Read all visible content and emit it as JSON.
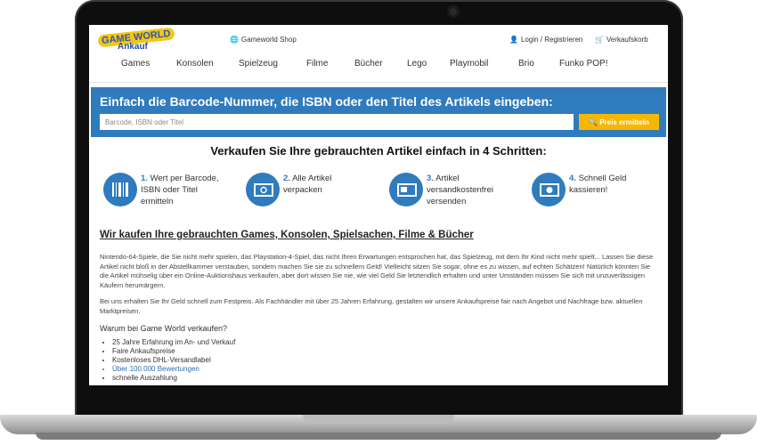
{
  "header": {
    "logo_top": "GAME WORLD",
    "logo_bottom": "Ankauf",
    "shop_link": "Gameworld Shop",
    "login_link": "Login / Registrieren",
    "cart_link": "Verkaufskorb"
  },
  "nav": [
    "Games",
    "Konsolen",
    "Spielzeug",
    "Filme",
    "Bücher",
    "Lego",
    "Playmobil",
    "Brio",
    "Funko POP!"
  ],
  "search": {
    "title": "Einfach die Barcode-Nummer, die ISBN oder den Titel des Artikels eingeben:",
    "placeholder": "Barcode, ISBN oder Titel",
    "button": "Preis ermitteln",
    "accent": "#2f7bbd",
    "button_color": "#f5b800"
  },
  "steps": {
    "title": "Verkaufen Sie Ihre gebrauchten Artikel einfach in 4 Schritten:",
    "items": [
      {
        "num": "1.",
        "text": "Wert per Barcode, ISBN oder Titel ermitteln",
        "icon": "barcode-icon"
      },
      {
        "num": "2.",
        "text": "Alle Artikel verpacken",
        "icon": "package-icon"
      },
      {
        "num": "3.",
        "text": "Artikel versandkostenfrei versenden",
        "icon": "shipping-icon"
      },
      {
        "num": "4.",
        "text": "Schnell Geld kassieren!",
        "icon": "money-icon"
      }
    ]
  },
  "content": {
    "heading": "Wir kaufen Ihre gebrauchten Games, Konsolen, Spielsachen, Filme & Bücher",
    "para1": "Nintendo-64-Spiele, die Sie nicht mehr spielen, das Playstation-4-Spiel, das nicht Ihren Erwartungen entsprochen hat, das Spielzeug, mit dem Ihr Kind nicht mehr spielt... Lassen Sie diese Artikel nicht bloß in der Abstellkammer verstauben, sondern machen Sie sie zu schnellem Geld! Vielleicht sitzen Sie sogar, ohne es zu wissen, auf echten Schätzen! Natürlich könnten Sie die Artikel mühselig über ein Online-Auktionshaus verkaufen, aber dort wissen Sie nie, wie viel Geld Sie letztendlich erhalten und unter Umständen müssen Sie sich mit unzuverlässigen Käufern herumärgern.",
    "para2": "Bei uns erhalten Sie Ihr Geld schnell zum Festpreis. Als Fachhändler mit über 25 Jahren Erfahrung, gestalten wir unsere Ankaufspreise fair nach Angebot und Nachfrage bzw. aktuellen Marktpreisen.",
    "why_title": "Warum bei Game World verkaufen?",
    "why_items": [
      "25 Jahre Erfahrung im An- und Verkauf",
      "Faire Ankaufspreise",
      "Kostenloses DHL-Versandlabel",
      "Über 100.000 Bewertungen",
      "schnelle Auszahlung"
    ]
  }
}
